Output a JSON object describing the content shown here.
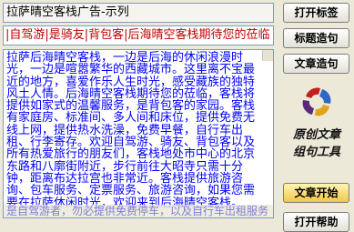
{
  "title_field": "拉萨晴空客栈广告-示列",
  "keywords": "|自驾游|是骑友|背包客|后海晴空客栈期待您的莅临",
  "article_content": "拉萨后海晴空客栈，一边是后海的休闲浪漫时光，一边是喧嚣繁华的西藏城市。这里离不宝最近的地方，喜爱作乐人生时光，感受藏族的独特风土人情。后海晴空客栈期待您的莅临，客栈将提供如家式的温馨服务，是背包客的家园。客栈有家庭房、标准间、多人间和床位，提供免费无线上网，提供热水洗澡，免费早餐，自行车出租、行李寄存。欢迎自驾游、骑友、背包客以及所有热爱旅行的朋友们，客栈地处市中心的北京东路和八廓街附近，步行前往大昭寺只需十分钟，距离布达拉宫也非常近。客栈提供旅游咨询、包车服务、定票服务、旅游咨询，如果您需要在拉萨休闲时光，欢迎来到后海晴空客栈。",
  "hint_text": "是自驾游者，勿必提供免费停车，以及自行车出租服务",
  "buttons": {
    "open": "打开标签",
    "title": "标题造句",
    "article": "文章造句",
    "start": "文章开始",
    "help": "打开帮助"
  },
  "logo": {
    "line1": "原创文章",
    "line2": "组句工具"
  },
  "colors": {
    "content_text": "#0000ff",
    "keywords_text": "#c00000",
    "window_bg": "#ece9d8",
    "button_yellow": "#f1c64c"
  }
}
